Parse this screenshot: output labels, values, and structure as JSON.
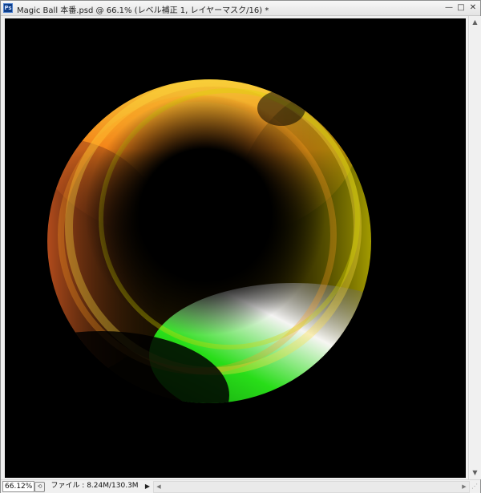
{
  "window": {
    "app_icon": "photoshop-icon",
    "app_icon_text": "Ps",
    "title": "Magic Ball 本番.psd @ 66.1% (レベル補正 1, レイヤーマスク/16) *",
    "buttons": {
      "minimize": "—",
      "maximize": "□",
      "close": "✕"
    }
  },
  "canvas": {
    "background": "#000000",
    "artwork": "glowing-sphere"
  },
  "scrollbars": {
    "up_arrow": "▲",
    "down_arrow": "▼",
    "left_arrow": "◀",
    "right_arrow": "▶"
  },
  "status": {
    "zoom": "66.12%",
    "doc_info": "ファイル : 8.24M/130.3M",
    "menu_arrow": "▶",
    "grip": "⋰"
  },
  "colors": {
    "sphere_yellow": "#e8e800",
    "sphere_orange": "#ff9a1a",
    "sphere_magenta": "#ff1a5e",
    "sphere_green": "#29e81a"
  }
}
